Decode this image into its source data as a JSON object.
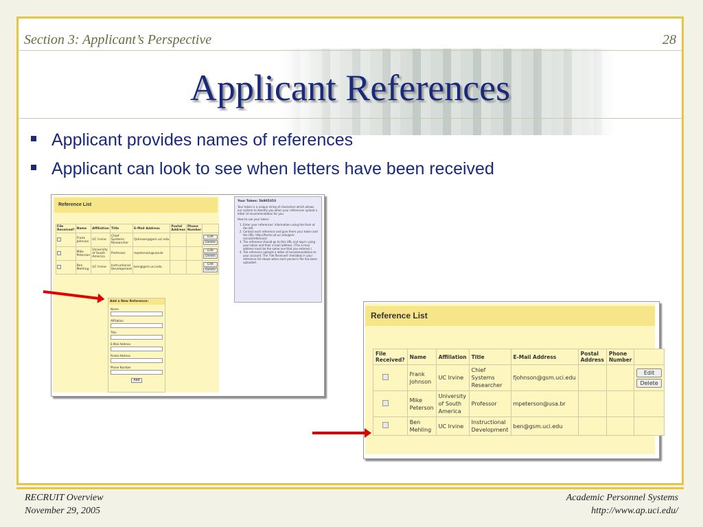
{
  "header": {
    "section": "Section 3: Applicant’s Perspective",
    "page_number": "28"
  },
  "title": "Applicant References",
  "bullets": [
    "Applicant provides names of references",
    "Applicant can look to see when letters have been received"
  ],
  "reference_list": {
    "heading": "Reference List",
    "columns": [
      "File Received?",
      "Name",
      "Affiliation",
      "Title",
      "E-Mail Address",
      "Postal Address",
      "Phone Number"
    ],
    "rows": [
      {
        "name": "Frank Johnson",
        "affiliation": "UC Irvine",
        "title": "Chief Systems Researcher",
        "email": "fjohnson@gsm.uci.edu"
      },
      {
        "name": "Mike Peterson",
        "affiliation": "University of South America",
        "title": "Professor",
        "email": "mpeterson@usa.br"
      },
      {
        "name": "Ben Mehling",
        "affiliation": "UC Irvine",
        "title": "Instructional Development",
        "email": "ben@gsm.uci.edu"
      }
    ],
    "edit_label": "Edit",
    "delete_label": "Delete"
  },
  "add_reference": {
    "heading": "Add a New Reference:",
    "fields": [
      "Name",
      "Affiliation",
      "Title",
      "E-Mail Address",
      "Postal Address",
      "Phone Number"
    ],
    "add_label": "Add"
  },
  "token": {
    "title": "Your Token: 5b805353",
    "intro": "Your token is a unique string of characters which allows our system to identify you when your references upload a letter of recommendation for you.",
    "how_to": "How to use your token:",
    "steps": [
      "Enter your references' information using the form at the left.",
      "Contact each reference and give them your token and the URL: http://forms.oit.uci.edu/gsm-recruit/reference/",
      "The reference should go to this URL and log-in using your token and their e-mail address. (The e-mail address must be the same one that you entered.)",
      "The reference uploads a letter of recommendation to your account. The 'File Received' checkbox in your reference list shows when each person's file has been uploaded."
    ]
  },
  "footer": {
    "left_line1": "RECRUIT Overview",
    "left_line2": "November 29, 2005",
    "right_line1": "Academic Personnel Systems",
    "right_line2": "http://www.ap.uci.edu/"
  },
  "colors": {
    "title": "#1a2a7a",
    "border": "#e8c53a",
    "panel": "#fdf6bf",
    "header_bar": "#f7e58a",
    "arrow": "#e00000"
  }
}
